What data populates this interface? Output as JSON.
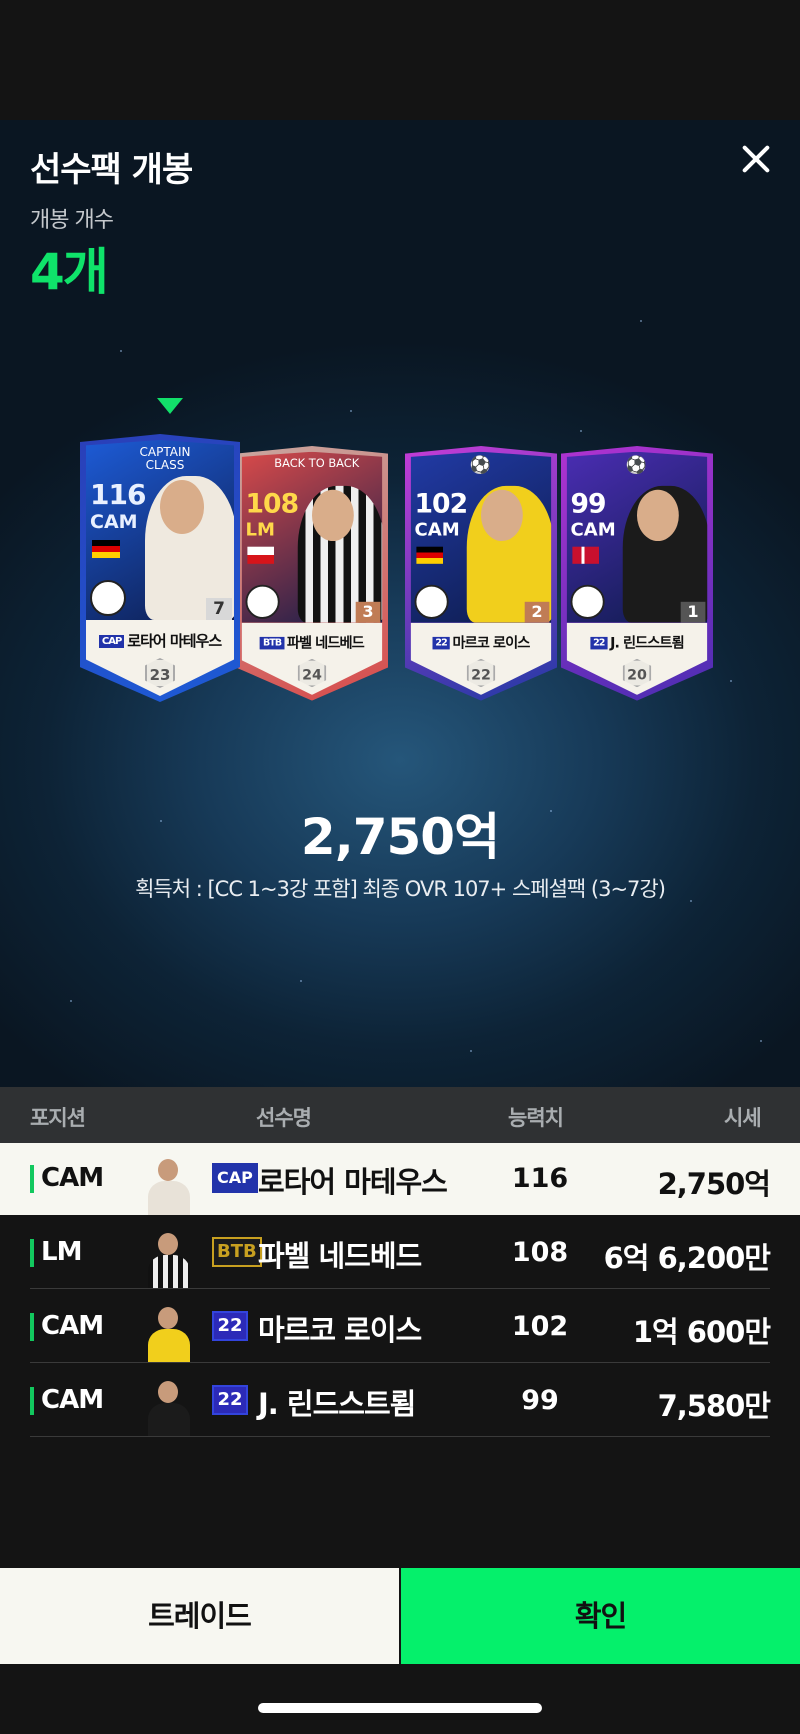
{
  "header": {
    "title": "선수팩 개봉",
    "count_label": "개봉 개수",
    "count_value": "4개"
  },
  "cards": [
    {
      "ovr": "116",
      "pos": "CAM",
      "tag": "CAPTAIN CLASS",
      "name": "로타어 마테우스",
      "season_badge": "CAP",
      "level": "23",
      "grade": "7",
      "top_color": "#1d5bd6",
      "edge_color": "#2a3fb8",
      "accent": "#e9f0ff"
    },
    {
      "ovr": "108",
      "pos": "LM",
      "tag": "BACK TO BACK",
      "name": "파벨 네드베드",
      "season_badge": "BTB",
      "level": "24",
      "grade": "3",
      "top_color": "#d84a4a",
      "edge_color": "#c8a7a0",
      "accent": "#ffd84a"
    },
    {
      "ovr": "102",
      "pos": "CAM",
      "tag": "⚽",
      "name": "마르코 로이스",
      "season_badge": "22",
      "level": "22",
      "grade": "2",
      "top_color": "#213aa5",
      "edge_color": "#c43cd6",
      "accent": "#ffffff"
    },
    {
      "ovr": "99",
      "pos": "CAM",
      "tag": "⚽",
      "name": "J. 린드스트룀",
      "season_badge": "22",
      "level": "20",
      "grade": "1",
      "top_color": "#4a2db2",
      "edge_color": "#b033d0",
      "accent": "#ffffff"
    }
  ],
  "summary": {
    "price": "2,750억",
    "source": "획득처 : [CC 1~3강 포함] 최종 OVR 107+ 스페셜팩 (3~7강)"
  },
  "table": {
    "headers": {
      "position": "포지션",
      "name": "선수명",
      "ovr": "능력치",
      "price": "시세"
    },
    "rows": [
      {
        "position": "CAM",
        "badge": "CAP",
        "name": "로타어 마테우스",
        "ovr": "116",
        "price": "2,750억",
        "badge_color": "#2233aa"
      },
      {
        "position": "LM",
        "badge": "BTB",
        "name": "파벨 네드베드",
        "ovr": "108",
        "price": "6억 6,200만",
        "badge_color": "#c8a020"
      },
      {
        "position": "CAM",
        "badge": "22",
        "name": "마르코 로이스",
        "ovr": "102",
        "price": "1억 600만",
        "badge_color": "#3344dd"
      },
      {
        "position": "CAM",
        "badge": "22",
        "name": "J. 린드스트룀",
        "ovr": "99",
        "price": "7,580만",
        "badge_color": "#3344dd"
      }
    ]
  },
  "buttons": {
    "trade": "트레이드",
    "confirm": "확인"
  },
  "colors": {
    "accent_green": "#0fe36a",
    "confirm_bg": "#05f06b"
  }
}
